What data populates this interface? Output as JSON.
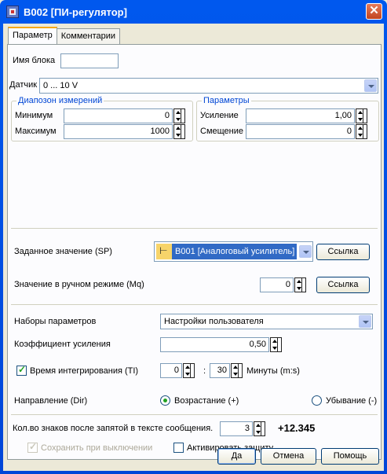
{
  "window": {
    "title": "B002 [ПИ-регулятор]",
    "close_label": "✕"
  },
  "tabs": [
    {
      "label": "Параметр",
      "active": true
    },
    {
      "label": "Комментарии",
      "active": false
    }
  ],
  "block": {
    "name_label": "Имя блока",
    "name_value": ""
  },
  "sensor": {
    "label": "Датчик",
    "value": "0 ... 10 V"
  },
  "range_group": {
    "title": "Диапозон измерений",
    "min_label": "Минимум",
    "min_value": "0",
    "max_label": "Максимум",
    "max_value": "1000"
  },
  "params_group": {
    "title": "Параметры",
    "gain_label": "Усиление",
    "gain_value": "1,00",
    "offset_label": "Смещение",
    "offset_value": "0"
  },
  "setpoint": {
    "label": "Заданное значение (SP)",
    "value": "B001 [Аналоговый усилитель]",
    "link_button": "Ссылка"
  },
  "manual": {
    "label": "Значение в ручном режиме (Mq)",
    "value": "0",
    "link_button": "Ссылка"
  },
  "param_sets": {
    "label": "Наборы параметров",
    "value": "Настройки пользователя"
  },
  "gain_coef": {
    "label": "Коэффициент усиления",
    "value": "0,50"
  },
  "integration": {
    "label": "Время интегрирования (TI)",
    "checked": true,
    "minutes": "0",
    "separator": ":",
    "seconds": "30",
    "unit": "Минуты (m:s)"
  },
  "direction": {
    "label": "Направление (Dir)",
    "increase_label": "Возрастание (+)",
    "decrease_label": "Убывание (-)",
    "selected": "increase"
  },
  "decimals": {
    "label": "Кол.во знаков после запятой в тексте сообщения.",
    "value": "3",
    "sample": "+12.345"
  },
  "options": {
    "retain_label": "Сохранить при выключении",
    "retain_checked": true,
    "protect_label": "Активировать защиту",
    "protect_checked": false
  },
  "buttons": {
    "ok": "Да",
    "cancel": "Отмена",
    "help": "Помощь"
  }
}
